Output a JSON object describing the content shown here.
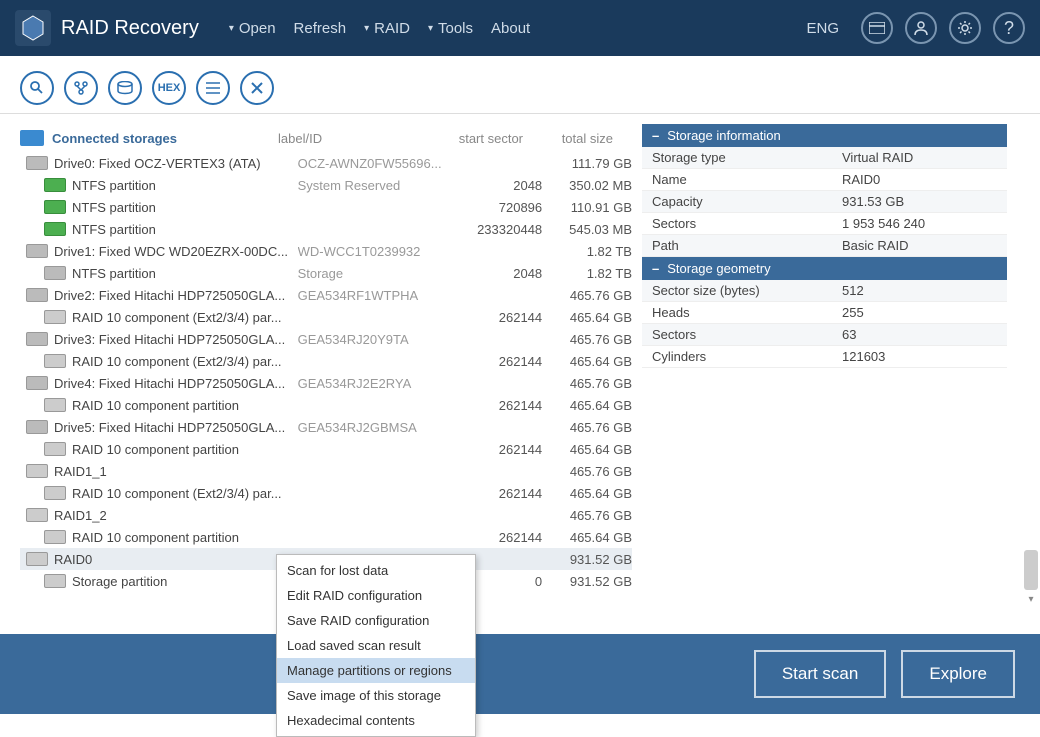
{
  "app_title": "RAID Recovery",
  "menu": {
    "open": "Open",
    "refresh": "Refresh",
    "raid": "RAID",
    "tools": "Tools",
    "about": "About"
  },
  "lang": "ENG",
  "pane_title": "Connected storages",
  "cols": {
    "label": "label/ID",
    "sector": "start sector",
    "size": "total size"
  },
  "rows": [
    {
      "icon": "drive",
      "indent": 0,
      "name": "Drive0: Fixed OCZ-VERTEX3 (ATA)",
      "label": "OCZ-AWNZ0FW55696...",
      "sector": "",
      "size": "111.79 GB"
    },
    {
      "icon": "part",
      "indent": 1,
      "name": "NTFS partition",
      "label": "System Reserved",
      "sector": "2048",
      "size": "350.02 MB"
    },
    {
      "icon": "part",
      "indent": 1,
      "name": "NTFS partition",
      "label": "",
      "sector": "720896",
      "size": "110.91 GB"
    },
    {
      "icon": "part",
      "indent": 1,
      "name": "NTFS partition",
      "label": "",
      "sector": "233320448",
      "size": "545.03 MB"
    },
    {
      "icon": "drive",
      "indent": 0,
      "name": "Drive1: Fixed WDC WD20EZRX-00DC...",
      "label": "WD-WCC1T0239932",
      "sector": "",
      "size": "1.82 TB"
    },
    {
      "icon": "part-gray",
      "indent": 1,
      "name": "NTFS partition",
      "label": "Storage",
      "sector": "2048",
      "size": "1.82 TB"
    },
    {
      "icon": "drive",
      "indent": 0,
      "name": "Drive2: Fixed Hitachi HDP725050GLA...",
      "label": "GEA534RF1WTPHA",
      "sector": "",
      "size": "465.76 GB"
    },
    {
      "icon": "raid",
      "indent": 1,
      "name": "RAID 10 component (Ext2/3/4) par...",
      "label": "",
      "sector": "262144",
      "size": "465.64 GB"
    },
    {
      "icon": "drive",
      "indent": 0,
      "name": "Drive3: Fixed Hitachi HDP725050GLA...",
      "label": "GEA534RJ20Y9TA",
      "sector": "",
      "size": "465.76 GB"
    },
    {
      "icon": "raid",
      "indent": 1,
      "name": "RAID 10 component (Ext2/3/4) par...",
      "label": "",
      "sector": "262144",
      "size": "465.64 GB"
    },
    {
      "icon": "drive",
      "indent": 0,
      "name": "Drive4: Fixed Hitachi HDP725050GLA...",
      "label": "GEA534RJ2E2RYA",
      "sector": "",
      "size": "465.76 GB"
    },
    {
      "icon": "raid",
      "indent": 1,
      "name": "RAID 10 component partition",
      "label": "",
      "sector": "262144",
      "size": "465.64 GB"
    },
    {
      "icon": "drive",
      "indent": 0,
      "name": "Drive5: Fixed Hitachi HDP725050GLA...",
      "label": "GEA534RJ2GBMSA",
      "sector": "",
      "size": "465.76 GB"
    },
    {
      "icon": "raid",
      "indent": 1,
      "name": "RAID 10 component partition",
      "label": "",
      "sector": "262144",
      "size": "465.64 GB"
    },
    {
      "icon": "raid",
      "indent": 0,
      "name": "RAID1_1",
      "label": "",
      "sector": "",
      "size": "465.76 GB"
    },
    {
      "icon": "raid",
      "indent": 1,
      "name": "RAID 10 component (Ext2/3/4) par...",
      "label": "",
      "sector": "262144",
      "size": "465.64 GB"
    },
    {
      "icon": "raid",
      "indent": 0,
      "name": "RAID1_2",
      "label": "",
      "sector": "",
      "size": "465.76 GB"
    },
    {
      "icon": "raid",
      "indent": 1,
      "name": "RAID 10 component partition",
      "label": "",
      "sector": "262144",
      "size": "465.64 GB"
    },
    {
      "icon": "raid",
      "indent": 0,
      "name": "RAID0",
      "label": "",
      "sector": "",
      "size": "931.52 GB",
      "selected": true
    },
    {
      "icon": "raid",
      "indent": 1,
      "name": "Storage partition",
      "label": "",
      "sector": "0",
      "size": "931.52 GB"
    }
  ],
  "context_menu": [
    "Scan for lost data",
    "Edit RAID configuration",
    "Save RAID configuration",
    "Load saved scan result",
    "Manage partitions or regions",
    "Save image of this storage",
    "Hexadecimal contents"
  ],
  "context_highlight_index": 4,
  "info_sections": {
    "storage": {
      "title": "Storage information",
      "rows": [
        [
          "Storage type",
          "Virtual RAID"
        ],
        [
          "Name",
          "RAID0"
        ],
        [
          "Capacity",
          "931.53 GB"
        ],
        [
          "Sectors",
          "1 953 546 240"
        ],
        [
          "Path",
          "Basic RAID"
        ]
      ]
    },
    "geometry": {
      "title": "Storage geometry",
      "rows": [
        [
          "Sector size (bytes)",
          "512"
        ],
        [
          "Heads",
          "255"
        ],
        [
          "Sectors",
          "63"
        ],
        [
          "Cylinders",
          "121603"
        ]
      ]
    }
  },
  "footer": {
    "start": "Start scan",
    "explore": "Explore"
  }
}
